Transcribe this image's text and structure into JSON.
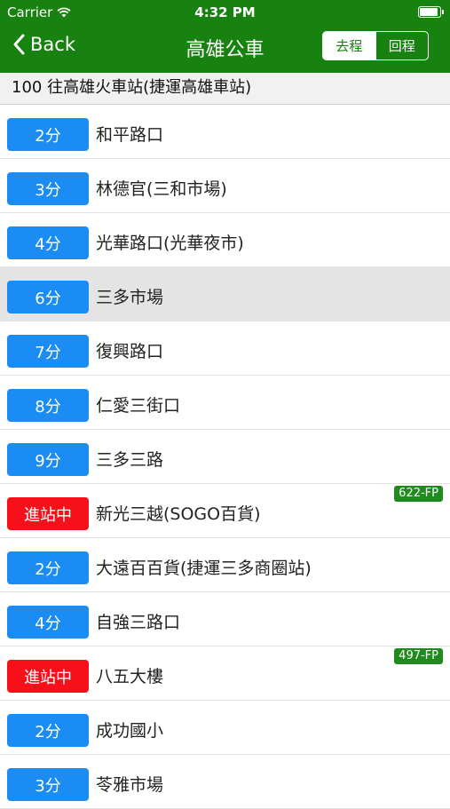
{
  "status_bar": {
    "carrier": "Carrier",
    "time": "4:32 PM"
  },
  "nav": {
    "back_label": "Back",
    "title": "高雄公車",
    "segments": [
      "去程",
      "回程"
    ],
    "selected_segment": "去程"
  },
  "route_header": "100 往高雄火車站(捷運高雄車站)",
  "stops": [
    {
      "eta": "2分",
      "name": "和平路口",
      "status": "normal",
      "plate": ""
    },
    {
      "eta": "3分",
      "name": "林德官(三和市場)",
      "status": "normal",
      "plate": ""
    },
    {
      "eta": "4分",
      "name": "光華路口(光華夜市)",
      "status": "normal",
      "plate": ""
    },
    {
      "eta": "6分",
      "name": "三多市場",
      "status": "normal",
      "plate": "",
      "highlighted": true
    },
    {
      "eta": "7分",
      "name": "復興路口",
      "status": "normal",
      "plate": ""
    },
    {
      "eta": "8分",
      "name": "仁愛三街口",
      "status": "normal",
      "plate": ""
    },
    {
      "eta": "9分",
      "name": "三多三路",
      "status": "normal",
      "plate": ""
    },
    {
      "eta": "進站中",
      "name": "新光三越(SOGO百貨)",
      "status": "arriving",
      "plate": "622-FP"
    },
    {
      "eta": "2分",
      "name": "大遠百百貨(捷運三多商圈站)",
      "status": "normal",
      "plate": ""
    },
    {
      "eta": "4分",
      "name": "自強三路口",
      "status": "normal",
      "plate": ""
    },
    {
      "eta": "進站中",
      "name": "八五大樓",
      "status": "arriving",
      "plate": "497-FP"
    },
    {
      "eta": "2分",
      "name": "成功國小",
      "status": "normal",
      "plate": ""
    },
    {
      "eta": "3分",
      "name": "苓雅市場",
      "status": "normal",
      "plate": ""
    }
  ],
  "colors": {
    "nav_green": "#17820f",
    "eta_blue": "#1a8cf3",
    "arriving_red": "#f70f1a",
    "plate_green": "#1f8b1c"
  }
}
